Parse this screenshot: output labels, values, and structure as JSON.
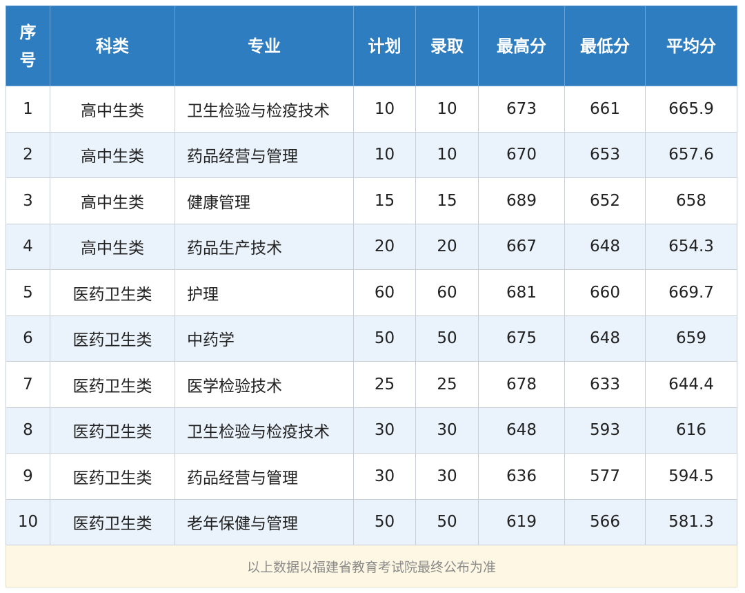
{
  "table": {
    "headers": {
      "seq_top": "序",
      "seq_bottom": "号",
      "category": "科类",
      "major": "专业",
      "plan": "计划",
      "admitted": "录取",
      "max_score": "最高分",
      "min_score": "最低分",
      "avg_score": "平均分"
    },
    "rows": [
      {
        "seq": "1",
        "category": "高中生类",
        "major": "卫生检验与检疫技术",
        "plan": "10",
        "admitted": "10",
        "max": "673",
        "min": "661",
        "avg": "665.9"
      },
      {
        "seq": "2",
        "category": "高中生类",
        "major": "药品经营与管理",
        "plan": "10",
        "admitted": "10",
        "max": "670",
        "min": "653",
        "avg": "657.6"
      },
      {
        "seq": "3",
        "category": "高中生类",
        "major": "健康管理",
        "plan": "15",
        "admitted": "15",
        "max": "689",
        "min": "652",
        "avg": "658"
      },
      {
        "seq": "4",
        "category": "高中生类",
        "major": "药品生产技术",
        "plan": "20",
        "admitted": "20",
        "max": "667",
        "min": "648",
        "avg": "654.3"
      },
      {
        "seq": "5",
        "category": "医药卫生类",
        "major": "护理",
        "plan": "60",
        "admitted": "60",
        "max": "681",
        "min": "660",
        "avg": "669.7"
      },
      {
        "seq": "6",
        "category": "医药卫生类",
        "major": "中药学",
        "plan": "50",
        "admitted": "50",
        "max": "675",
        "min": "648",
        "avg": "659"
      },
      {
        "seq": "7",
        "category": "医药卫生类",
        "major": "医学检验技术",
        "plan": "25",
        "admitted": "25",
        "max": "678",
        "min": "633",
        "avg": "644.4"
      },
      {
        "seq": "8",
        "category": "医药卫生类",
        "major": "卫生检验与检疫技术",
        "plan": "30",
        "admitted": "30",
        "max": "648",
        "min": "593",
        "avg": "616"
      },
      {
        "seq": "9",
        "category": "医药卫生类",
        "major": "药品经营与管理",
        "plan": "30",
        "admitted": "30",
        "max": "636",
        "min": "577",
        "avg": "594.5"
      },
      {
        "seq": "10",
        "category": "医药卫生类",
        "major": "老年保健与管理",
        "plan": "50",
        "admitted": "50",
        "max": "619",
        "min": "566",
        "avg": "581.3"
      }
    ],
    "footnote": "以上数据以福建省教育考试院最终公布为准"
  },
  "colors": {
    "header_bg": "#2f7dc1",
    "stripe_bg": "#eaf2fb",
    "footnote_bg": "#fdf7e3"
  }
}
